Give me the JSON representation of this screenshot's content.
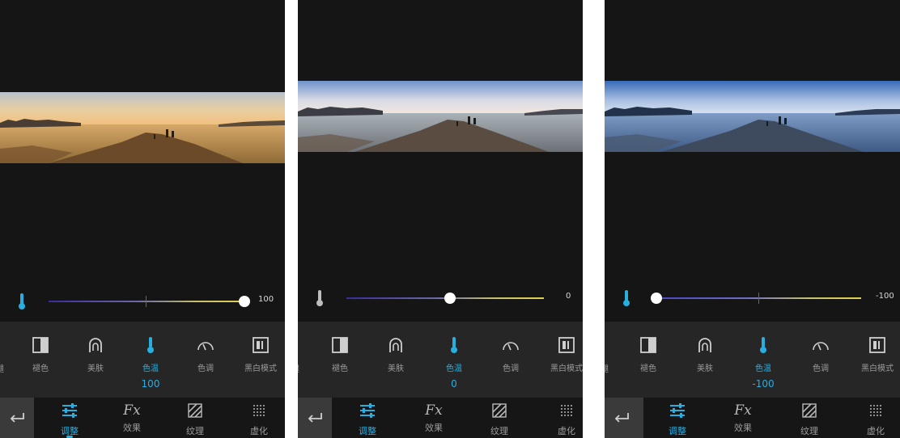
{
  "panels": [
    {
      "id": "warm",
      "slider_value": "100",
      "tool_value": "100",
      "photo_colors": {
        "sky_top": "#c9d3de",
        "sky_horizon": "#f0c98a",
        "water": "#b88a4a",
        "rock": "#6a4a28",
        "shore": "#4b3f35"
      }
    },
    {
      "id": "neutral",
      "slider_value": "0",
      "tool_value": "0",
      "photo_colors": {
        "sky_top": "#7e9ed0",
        "sky_horizon": "#e8e4e6",
        "water": "#8a96a0",
        "rock": "#5a4c40",
        "shore": "#3c3c44"
      }
    },
    {
      "id": "cool",
      "slider_value": "-100",
      "tool_value": "-100",
      "photo_colors": {
        "sky_top": "#3f74c2",
        "sky_horizon": "#c9d6ec",
        "water": "#5d7fa8",
        "rock": "#3e4a5e",
        "shore": "#22324a"
      }
    }
  ],
  "tools": {
    "left_cut": [
      "褪",
      "褪",
      "褪"
    ],
    "items": [
      {
        "label": "褪色",
        "icon": "fade-icon"
      },
      {
        "label": "美肤",
        "icon": "face-icon"
      },
      {
        "label": "色温",
        "icon": "thermometer-icon"
      },
      {
        "label": "色调",
        "icon": "tint-arc-icon"
      },
      {
        "label": "黑白模式",
        "icon": "bw-mode-icon"
      }
    ]
  },
  "bottom_tabs": [
    {
      "label": "调整",
      "icon": "sliders-icon"
    },
    {
      "label": "效果",
      "icon": "fx-icon",
      "glyph": "Fx"
    },
    {
      "label": "纹理",
      "icon": "texture-icon"
    },
    {
      "label": "虚化",
      "icon": "blur-icon"
    }
  ],
  "colors": {
    "accent": "#29aee0",
    "panel_bg": "#151515",
    "toolbar_bg": "#262626",
    "bottom_bg": "#161616"
  }
}
